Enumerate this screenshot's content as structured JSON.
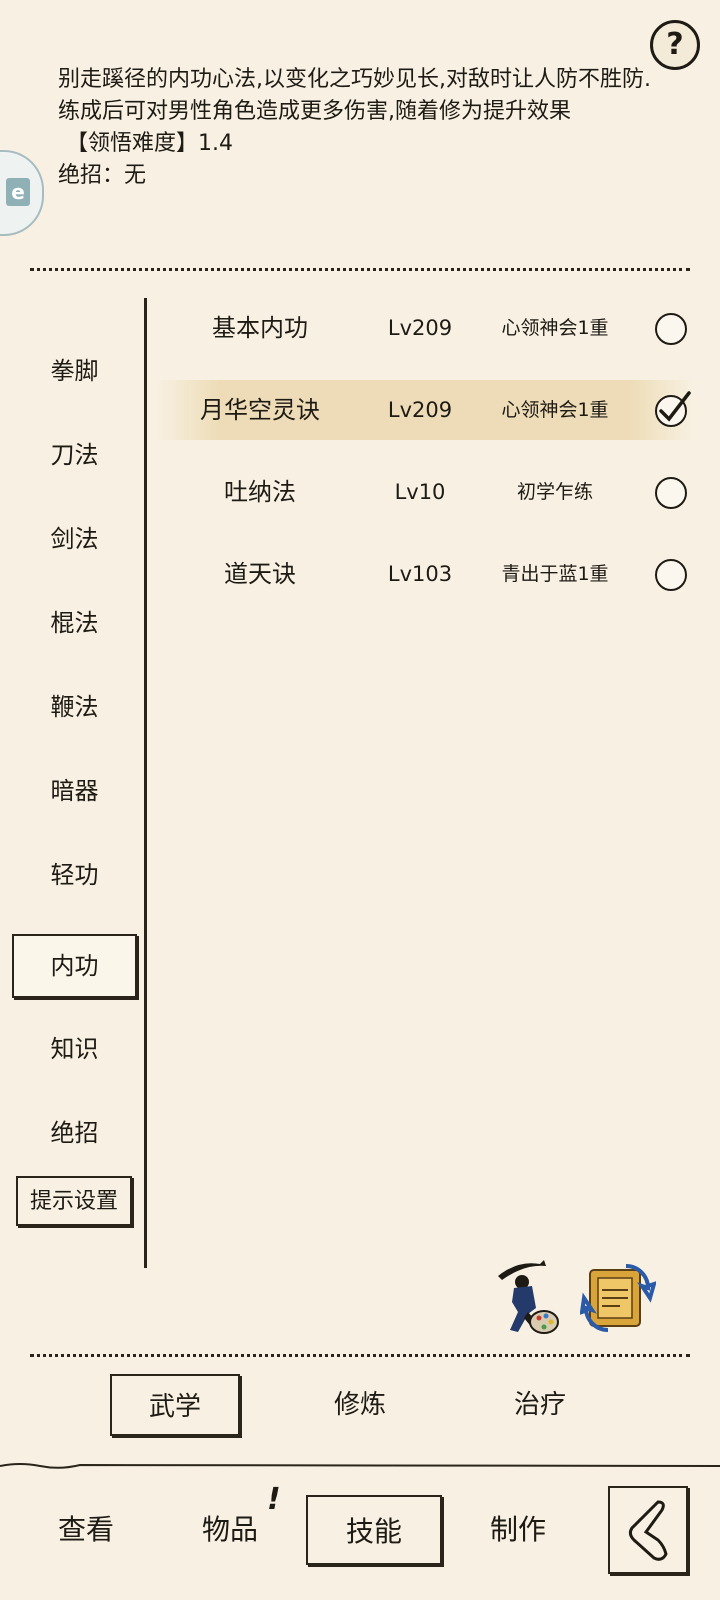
{
  "help": {
    "label": "?"
  },
  "description": {
    "text": "别走蹊径的内功心法,以变化之巧妙见长,对敌时让人防不胜防.练成后可对男性角色造成更多伤害,随着修为提升效果",
    "difficulty": "【领悟难度】1.4",
    "ultimate": "绝招：无"
  },
  "side_tab_mark": "e",
  "categories": [
    {
      "label": "拳脚"
    },
    {
      "label": "刀法"
    },
    {
      "label": "剑法"
    },
    {
      "label": "棍法"
    },
    {
      "label": "鞭法"
    },
    {
      "label": "暗器"
    },
    {
      "label": "轻功"
    },
    {
      "label": "内功",
      "active": true
    },
    {
      "label": "知识"
    },
    {
      "label": "绝招"
    }
  ],
  "hint_settings": "提示设置",
  "skills": [
    {
      "name": "基本内功",
      "level": "Lv209",
      "rank": "心领神会1重",
      "selected": false
    },
    {
      "name": "月华空灵诀",
      "level": "Lv209",
      "rank": "心领神会1重",
      "selected": true
    },
    {
      "name": "吐纳法",
      "level": "Lv10",
      "rank": "初学乍练",
      "selected": false
    },
    {
      "name": "道天诀",
      "level": "Lv103",
      "rank": "青出于蓝1重",
      "selected": false
    }
  ],
  "icons": {
    "martial": "swordsman-palette-icon",
    "swap": "swap-scroll-icon",
    "back": "back-arrow-icon"
  },
  "subtabs": [
    {
      "label": "武学",
      "active": true
    },
    {
      "label": "修炼",
      "active": false
    },
    {
      "label": "治疗",
      "active": false
    }
  ],
  "nav": [
    {
      "label": "查看",
      "active": false
    },
    {
      "label": "物品",
      "active": false,
      "badge": "!"
    },
    {
      "label": "技能",
      "active": true
    },
    {
      "label": "制作",
      "active": false
    }
  ],
  "colors": {
    "background": "#f8f1e3",
    "ink": "#1e1a14",
    "highlight": "#ecdab2"
  }
}
